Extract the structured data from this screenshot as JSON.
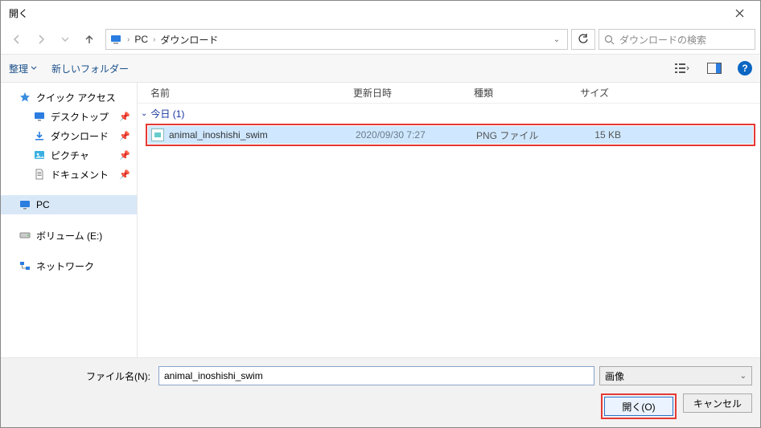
{
  "title": "開く",
  "breadcrumb": {
    "root": "PC",
    "folder": "ダウンロード"
  },
  "search": {
    "placeholder": "ダウンロードの検索"
  },
  "toolbar": {
    "organize": "整理",
    "newfolder": "新しいフォルダー"
  },
  "nav": {
    "quick_access": "クイック アクセス",
    "desktop": "デスクトップ",
    "downloads": "ダウンロード",
    "pictures": "ピクチャ",
    "documents": "ドキュメント",
    "pc": "PC",
    "volume_e": "ボリューム (E:)",
    "network": "ネットワーク"
  },
  "columns": {
    "name": "名前",
    "date": "更新日時",
    "type": "種類",
    "size": "サイズ"
  },
  "group": {
    "label": "今日 (1)"
  },
  "files": [
    {
      "name": "animal_inoshishi_swim",
      "date": "2020/09/30 7:27",
      "type": "PNG ファイル",
      "size": "15 KB"
    }
  ],
  "footer": {
    "filename_label": "ファイル名(N):",
    "filename_value": "animal_inoshishi_swim",
    "filter": "画像",
    "open": "開く(O)",
    "cancel": "キャンセル"
  }
}
